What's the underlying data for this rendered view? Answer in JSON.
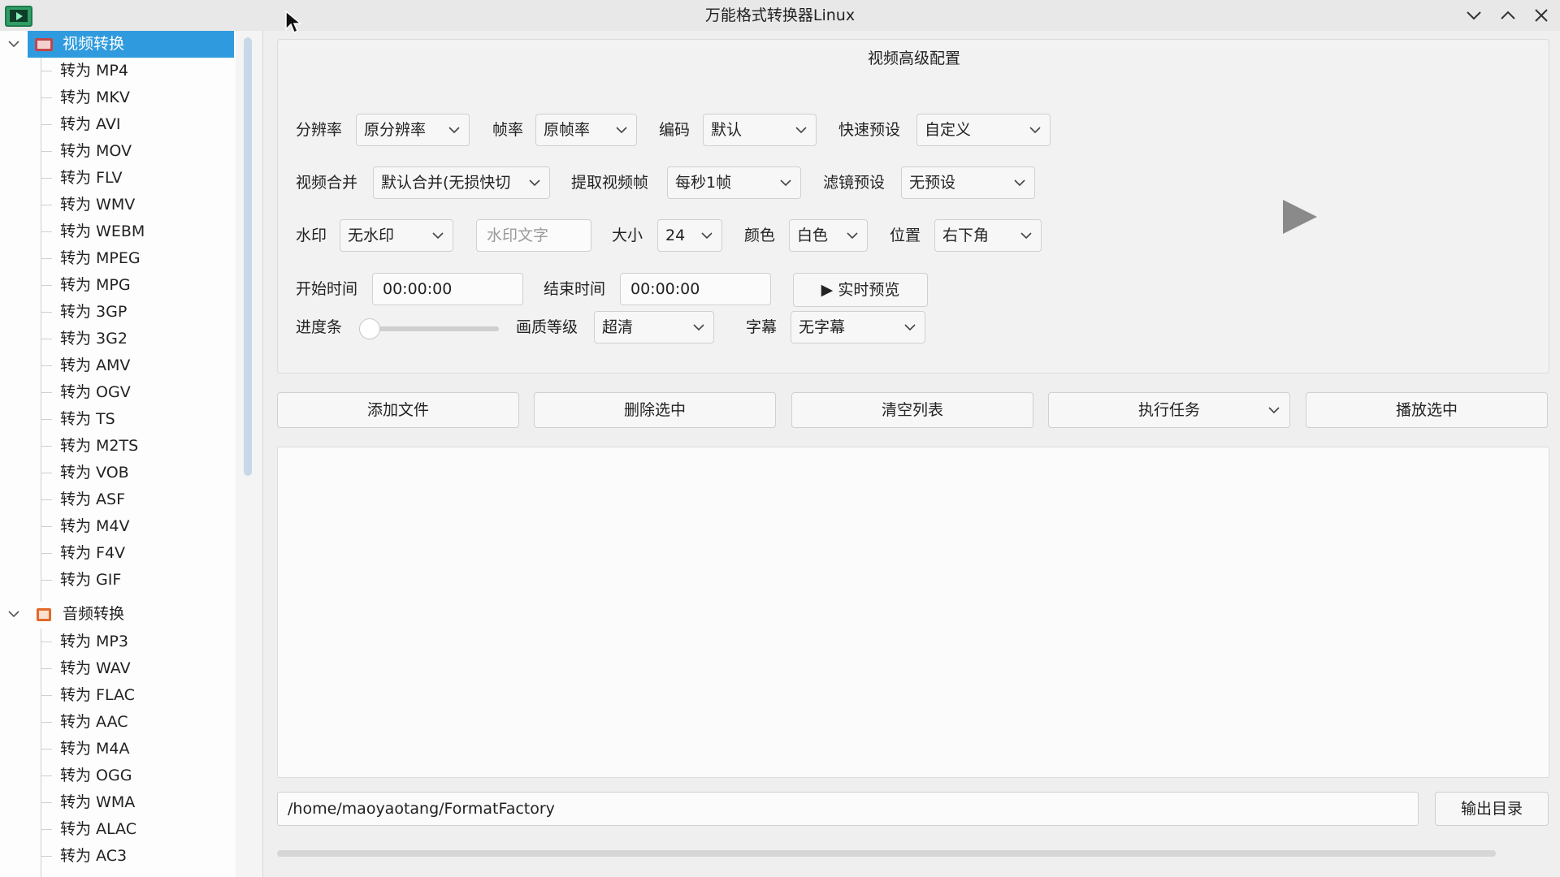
{
  "window": {
    "title": "万能格式转换器Linux"
  },
  "sidebar": {
    "categories": [
      {
        "label": "视频转换",
        "items": [
          "转为 MP4",
          "转为 MKV",
          "转为 AVI",
          "转为 MOV",
          "转为 FLV",
          "转为 WMV",
          "转为 WEBM",
          "转为 MPEG",
          "转为 MPG",
          "转为 3GP",
          "转为 3G2",
          "转为 AMV",
          "转为 OGV",
          "转为 TS",
          "转为 M2TS",
          "转为 VOB",
          "转为 ASF",
          "转为 M4V",
          "转为 F4V",
          "转为 GIF"
        ]
      },
      {
        "label": "音频转换",
        "items": [
          "转为 MP3",
          "转为 WAV",
          "转为 FLAC",
          "转为 AAC",
          "转为 M4A",
          "转为 OGG",
          "转为 WMA",
          "转为 ALAC",
          "转为 AC3"
        ]
      }
    ]
  },
  "config": {
    "title": "视频高级配置",
    "resolution_label": "分辨率",
    "resolution_value": "原分辨率",
    "framerate_label": "帧率",
    "framerate_value": "原帧率",
    "codec_label": "编码",
    "codec_value": "默认",
    "preset_label": "快速预设",
    "preset_value": "自定义",
    "merge_label": "视频合并",
    "merge_value": "默认合并(无损快切",
    "extract_label": "提取视频帧",
    "extract_value": "每秒1帧",
    "filter_label": "滤镜预设",
    "filter_value": "无预设",
    "watermark_label": "水印",
    "watermark_value": "无水印",
    "watermark_text_placeholder": "水印文字",
    "size_label": "大小",
    "size_value": "24",
    "color_label": "颜色",
    "color_value": "白色",
    "position_label": "位置",
    "position_value": "右下角",
    "start_label": "开始时间",
    "start_value": "00:00:00",
    "end_label": "结束时间",
    "end_value": "00:00:00",
    "preview_button": "▶ 实时预览",
    "progress_label": "进度条",
    "progress_value": 0,
    "quality_label": "画质等级",
    "quality_value": "超清",
    "subtitle_label": "字幕",
    "subtitle_value": "无字幕"
  },
  "actions": {
    "add": "添加文件",
    "delete": "删除选中",
    "clear": "清空列表",
    "run": "执行任务",
    "play": "播放选中"
  },
  "output": {
    "path": "/home/maoyaotang/FormatFactory",
    "button": "输出目录"
  },
  "icons": {
    "app": "app-video-icon",
    "video_category": "video-category-icon",
    "audio_category": "audio-category-icon"
  },
  "colors": {
    "selection": "#2f9bde",
    "app_icon": "#2f9e66"
  }
}
